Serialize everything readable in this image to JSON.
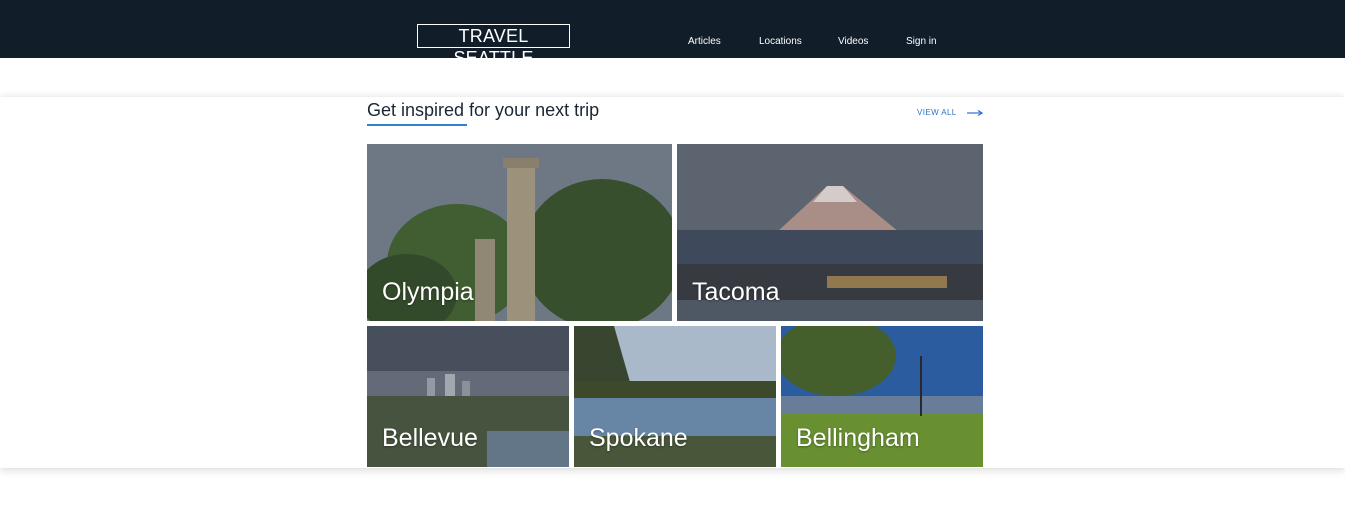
{
  "header": {
    "logo": "TRAVEL SEATTLE",
    "nav": [
      "Articles",
      "Locations",
      "Videos",
      "Sign in"
    ]
  },
  "section": {
    "title": "Get inspired for your next trip",
    "view_all": "VIEW ALL",
    "accent_color": "#2f80d1"
  },
  "destinations": [
    "Olympia",
    "Tacoma",
    "Bellevue",
    "Spokane",
    "Bellingham"
  ],
  "colors": {
    "header_bg": "#111d29",
    "text_dark": "#1b2634",
    "link": "#2f72c9"
  }
}
